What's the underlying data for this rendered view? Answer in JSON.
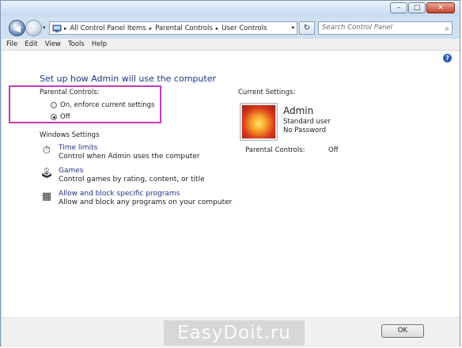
{
  "window": {
    "buttons": {
      "minimize": "–",
      "maximize": "□",
      "close": "✕"
    }
  },
  "nav": {
    "back_glyph": "◀",
    "forward_glyph": "▶",
    "breadcrumbs": [
      "All Control Panel Items",
      "Parental Controls",
      "User Controls"
    ],
    "separator": "▸",
    "search_placeholder": "Search Control Panel",
    "refresh_glyph": "↻",
    "search_glyph": "⌕"
  },
  "menu": [
    "File",
    "Edit",
    "View",
    "Tools",
    "Help"
  ],
  "main": {
    "help_glyph": "?",
    "heading": "Set up how Admin will use the computer",
    "parental_controls_label": "Parental Controls:",
    "radio_on": "On, enforce current settings",
    "radio_off": "Off",
    "selected": "Off",
    "windows_settings_label": "Windows Settings",
    "settings": [
      {
        "title": "Time limits",
        "desc": "Control when Admin uses the computer",
        "icon": "clock-icon"
      },
      {
        "title": "Games",
        "desc": "Control games by rating, content, or title",
        "icon": "joystick-icon"
      },
      {
        "title": "Allow and block specific programs",
        "desc": "Allow and block any programs on your computer",
        "icon": "programs-icon"
      }
    ],
    "current_settings_label": "Current Settings:",
    "user_name": "Admin",
    "user_type": "Standard user",
    "user_password": "No Password",
    "pc_status_label": "Parental Controls:",
    "pc_status_value": "Off"
  },
  "footer": {
    "ok_label": "OK",
    "watermark": "EasyDoit.ru"
  },
  "colors": {
    "highlight_border": "#c23ab8",
    "heading_blue": "#1e3287"
  }
}
